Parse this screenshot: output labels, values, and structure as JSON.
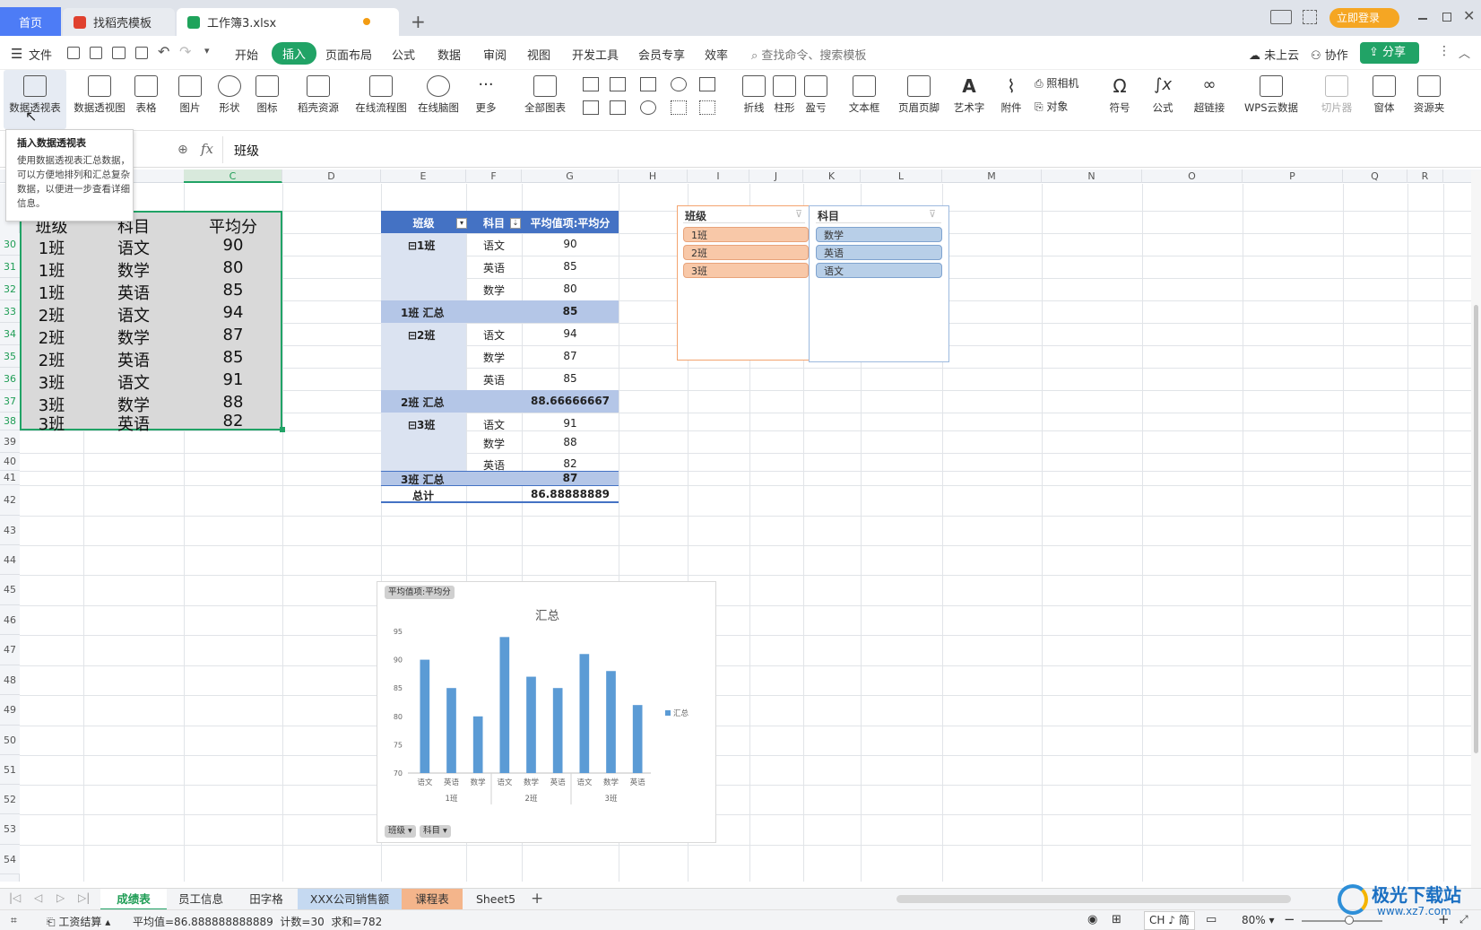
{
  "tabs": {
    "home": "首页",
    "template": "找稻壳模板",
    "file": "工作簿3.xlsx",
    "login": "立即登录"
  },
  "menu": {
    "file": "文件",
    "items": [
      "开始",
      "插入",
      "页面布局",
      "公式",
      "数据",
      "审阅",
      "视图",
      "开发工具",
      "会员专享",
      "效率"
    ],
    "search_placeholder": "查找命令、搜索模板",
    "cloud": "未上云",
    "collab": "协作",
    "share": "分享"
  },
  "ribbon": {
    "items": [
      "数据透视表",
      "数据透视图",
      "表格",
      "图片",
      "形状",
      "图标",
      "稻壳资源",
      "在线流程图",
      "在线脑图",
      "更多",
      "全部图表",
      "折线",
      "柱形",
      "盈亏",
      "文本框",
      "页眉页脚",
      "艺术字",
      "附件",
      "照相机",
      "对象",
      "符号",
      "公式",
      "超链接",
      "WPS云数据",
      "切片器",
      "窗体",
      "资源夹"
    ]
  },
  "tooltip": {
    "title": "插入数据透视表",
    "body": "使用数据透视表汇总数据，可以方便地排列和汇总复杂数据，以便进一步查看详细信息。"
  },
  "formula_bar": {
    "fx": "fx",
    "value": "班级"
  },
  "columns": [
    "C",
    "D",
    "E",
    "F",
    "G",
    "H",
    "I",
    "J",
    "K",
    "L",
    "M",
    "N",
    "O",
    "P",
    "Q",
    "R"
  ],
  "row_numbers": [
    "30",
    "31",
    "32",
    "33",
    "34",
    "35",
    "36",
    "37",
    "38",
    "39",
    "40",
    "41",
    "42",
    "43",
    "44",
    "45",
    "46",
    "47",
    "48",
    "49",
    "50",
    "51",
    "52",
    "53",
    "54"
  ],
  "source_table": {
    "headers": [
      "班级",
      "科目",
      "平均分"
    ],
    "rows": [
      [
        "1班",
        "语文",
        "90"
      ],
      [
        "1班",
        "数学",
        "80"
      ],
      [
        "1班",
        "英语",
        "85"
      ],
      [
        "2班",
        "语文",
        "94"
      ],
      [
        "2班",
        "数学",
        "87"
      ],
      [
        "2班",
        "英语",
        "85"
      ],
      [
        "3班",
        "语文",
        "91"
      ],
      [
        "3班",
        "数学",
        "88"
      ],
      [
        "3班",
        "英语",
        "82"
      ]
    ]
  },
  "pivot": {
    "headers": [
      "班级",
      "科目",
      "平均值项:平均分"
    ],
    "groups": [
      {
        "class": "⊟1班",
        "rows": [
          [
            "语文",
            "90"
          ],
          [
            "英语",
            "85"
          ],
          [
            "数学",
            "80"
          ]
        ],
        "subtotal_label": "1班 汇总",
        "subtotal": "85"
      },
      {
        "class": "⊟2班",
        "rows": [
          [
            "语文",
            "94"
          ],
          [
            "数学",
            "87"
          ],
          [
            "英语",
            "85"
          ]
        ],
        "subtotal_label": "2班 汇总",
        "subtotal": "88.66666667"
      },
      {
        "class": "⊟3班",
        "rows": [
          [
            "语文",
            "91"
          ],
          [
            "数学",
            "88"
          ],
          [
            "英语",
            "82"
          ]
        ],
        "subtotal_label": "3班 汇总",
        "subtotal": "87"
      }
    ],
    "total_label": "总计",
    "total": "86.88888889"
  },
  "slicers": {
    "class": {
      "title": "班级",
      "items": [
        "1班",
        "2班",
        "3班"
      ]
    },
    "subject": {
      "title": "科目",
      "items": [
        "数学",
        "英语",
        "语文"
      ]
    }
  },
  "chart_data": {
    "type": "bar",
    "title": "汇总",
    "field_button": "平均值项:平均分",
    "axis_buttons": [
      "班级",
      "科目"
    ],
    "categories": [
      "语文",
      "英语",
      "数学",
      "语文",
      "数学",
      "英语",
      "语文",
      "数学",
      "英语"
    ],
    "groups": [
      "1班",
      "2班",
      "3班"
    ],
    "series": [
      {
        "name": "汇总",
        "values": [
          90,
          85,
          80,
          94,
          87,
          85,
          91,
          88,
          82
        ]
      }
    ],
    "ylim": [
      70,
      95
    ],
    "yticks": [
      70,
      75,
      80,
      85,
      90,
      95
    ],
    "color": "#5b9bd5",
    "legend": "right"
  },
  "sheets": [
    "成绩表",
    "员工信息",
    "田字格",
    "XXX公司销售额",
    "课程表",
    "Sheet5"
  ],
  "status": {
    "macro": "工资结算",
    "summary": "平均值=86.888888888889  计数=30  求和=782",
    "ime": "CH ♪ 简",
    "zoom": "80%"
  },
  "watermark": {
    "text": "极光下载站",
    "url": "www.xz7.com"
  }
}
